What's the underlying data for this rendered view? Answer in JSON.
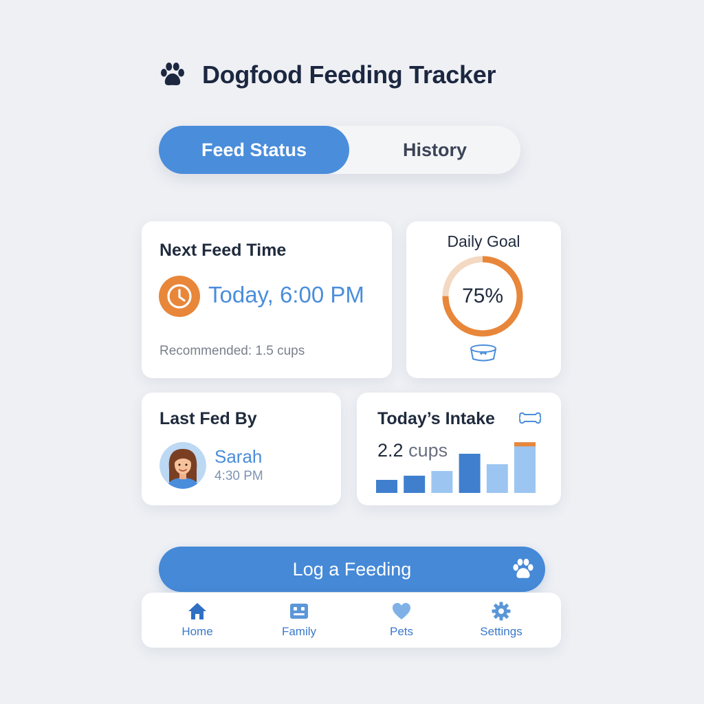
{
  "header": {
    "title": "Dogfood Feeding Tracker",
    "logo_icon": "paw-icon"
  },
  "tabs": [
    {
      "label": "Feed Status",
      "active": true
    },
    {
      "label": "History",
      "active": false
    }
  ],
  "next_feed": {
    "title": "Next Feed Time",
    "time": "Today, 6:00 PM",
    "recommended": "Recommended: 1.5 cups",
    "icon": "clock-icon"
  },
  "daily_goal": {
    "title": "Daily Goal",
    "percent_label": "75%",
    "progress": 0.75,
    "icon": "bowl-icon"
  },
  "last_fed": {
    "title": "Last Fed By",
    "name": "Sarah",
    "time": "4:30 PM"
  },
  "intake": {
    "title": "Today’s Intake",
    "value": "2.2",
    "unit": "cups",
    "icon": "bone-icon",
    "bars": [
      0.25,
      0.33,
      0.42,
      0.75,
      0.55,
      0.97
    ]
  },
  "log_button": {
    "label": "Log a Feeding"
  },
  "nav": [
    {
      "label": "Home",
      "icon": "home-icon"
    },
    {
      "label": "Family",
      "icon": "family-icon"
    },
    {
      "label": "Pets",
      "icon": "heart-icon"
    },
    {
      "label": "Settings",
      "icon": "gear-icon"
    }
  ],
  "colors": {
    "accent": "#4a8ddb",
    "orange": "#e8863a",
    "background": "#eef0f4",
    "title": "#1f2a3d"
  }
}
